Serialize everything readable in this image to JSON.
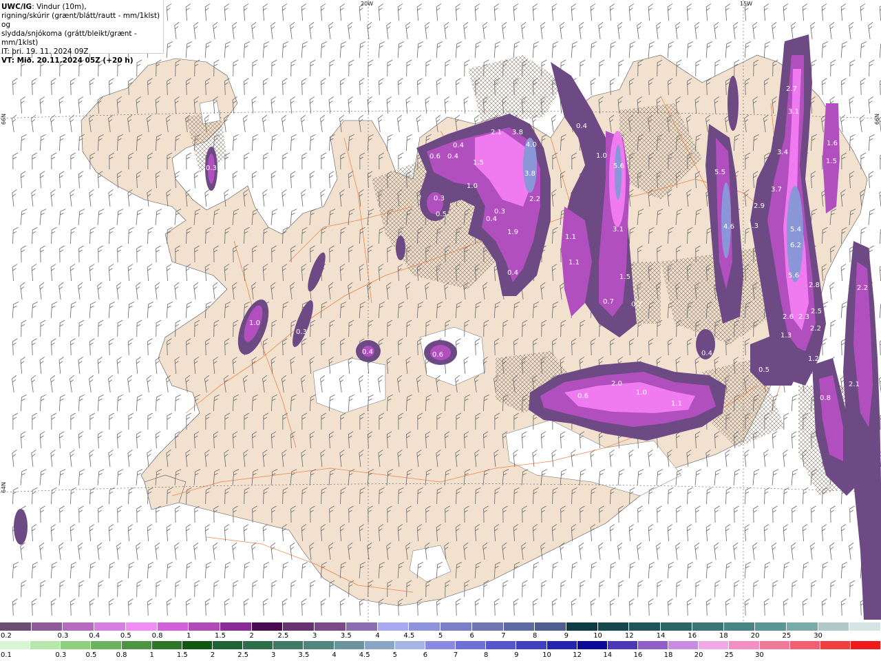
{
  "header": {
    "model": "UWC/IG",
    "line1_rest": ": Vindur (10m),",
    "line2": "rigning/skúrir (grænt/blátt/rautt - mm/1klst) og",
    "line3": "slydda/snjókoma (grátt/bleikt/grænt - mm/1klst)",
    "issue": "IT: þri. 19. 11. 2024 09Z",
    "valid": "VT: Mið. 20.11.2024 05Z (+20 h)"
  },
  "graticule": {
    "lon_top_1": "20W",
    "lon_top_2": "15W",
    "lat_left_1": "66N",
    "lat_left_2": "64N",
    "lat_right_1": "66N"
  },
  "colors": {
    "land": "#f2e1cf",
    "sea": "#ffffff",
    "roads": "#ee7a3a",
    "snow_low": "#6e4a84",
    "snow_mid": "#b24fbf",
    "snow_high": "#f07bf0",
    "snow_core": "#8a96d8"
  },
  "precip_labels": [
    {
      "text": "0.3"
    },
    {
      "text": "1.0"
    },
    {
      "text": "0.3"
    },
    {
      "text": "0.4"
    },
    {
      "text": "0.6"
    },
    {
      "text": "0.6"
    },
    {
      "text": "0.4"
    },
    {
      "text": "1.5"
    },
    {
      "text": "1.0"
    },
    {
      "text": "0.3"
    },
    {
      "text": "0.5"
    },
    {
      "text": "0.4"
    },
    {
      "text": "2.1"
    },
    {
      "text": "3.8"
    },
    {
      "text": "4.0"
    },
    {
      "text": "3.8"
    },
    {
      "text": "2.2"
    },
    {
      "text": "1.9"
    },
    {
      "text": "0.3"
    },
    {
      "text": "0.4"
    },
    {
      "text": "0.4"
    },
    {
      "text": "1.1"
    },
    {
      "text": "1.1"
    },
    {
      "text": "1.0"
    },
    {
      "text": "5.6"
    },
    {
      "text": "3.1"
    },
    {
      "text": "1.5"
    },
    {
      "text": "0.7"
    },
    {
      "text": "0.7"
    },
    {
      "text": "0.4"
    },
    {
      "text": "5.5"
    },
    {
      "text": "4.6"
    },
    {
      "text": "1.3"
    },
    {
      "text": "2.9"
    },
    {
      "text": "3.7"
    },
    {
      "text": "3.4"
    },
    {
      "text": "3.1"
    },
    {
      "text": "2.7"
    },
    {
      "text": "5.4"
    },
    {
      "text": "6.2"
    },
    {
      "text": "5.6"
    },
    {
      "text": "2.8"
    },
    {
      "text": "2.6"
    },
    {
      "text": "2.3"
    },
    {
      "text": "2.5"
    },
    {
      "text": "2.2"
    },
    {
      "text": "1.3"
    },
    {
      "text": "1.2"
    },
    {
      "text": "0.5"
    },
    {
      "text": "2.0"
    },
    {
      "text": "0.6"
    },
    {
      "text": "1.0"
    },
    {
      "text": "1.1"
    },
    {
      "text": "0.4"
    },
    {
      "text": "2.2"
    },
    {
      "text": "2.1"
    },
    {
      "text": "0.8"
    },
    {
      "text": "1.6"
    },
    {
      "text": "1.5"
    }
  ],
  "legend_snow": {
    "colors": [
      "#6a4e74",
      "#8e5c99",
      "#b56cbf",
      "#d77fe0",
      "#ef8ff5",
      "#d062d8",
      "#b14ab9",
      "#8a2c95",
      "#4a0a4e",
      "#68316f",
      "#7a4b86",
      "#8b6fb0",
      "#a9a9f2",
      "#8d94dc",
      "#7a7fc6",
      "#6f76b0",
      "#5b6aa0",
      "#4f5e8e",
      "#0e3a44",
      "#16474f",
      "#1f5458",
      "#2c6565",
      "#3b7575",
      "#4a8585",
      "#5c9595",
      "#7baaaa",
      "#b0c8c8",
      "#d8e4e4"
    ],
    "labels": [
      "0.2",
      "0.3",
      "0.4",
      "0.5",
      "0.8",
      "1",
      "1.5",
      "2",
      "2.5",
      "3",
      "3.5",
      "4",
      "4.5",
      "5",
      "6",
      "7",
      "8",
      "9",
      "10",
      "12",
      "14",
      "16",
      "18",
      "20",
      "25",
      "30"
    ]
  },
  "legend_rain": {
    "colors": [
      "#d8f5d2",
      "#b6e7ab",
      "#8fd07f",
      "#6cb35d",
      "#4c9442",
      "#2d7728",
      "#0f5912",
      "#1e6335",
      "#2f6e4d",
      "#3f7a65",
      "#50867c",
      "#6a95a0",
      "#8aa6c4",
      "#a5b6e6",
      "#8a8ae2",
      "#6f6fd8",
      "#5656cc",
      "#3f3fbf",
      "#2424b0",
      "#0a0a9a",
      "#4b37b8",
      "#8f5ec9",
      "#c88de0",
      "#f0a8e6",
      "#f38fc2",
      "#f07a9a",
      "#f06070",
      "#ee3e3e",
      "#f01a1a"
    ],
    "labels": [
      "0.1",
      "0.3",
      "0.5",
      "0.8",
      "1",
      "1.5",
      "2",
      "2.5",
      "3",
      "3.5",
      "4",
      "4.5",
      "5",
      "6",
      "7",
      "8",
      "9",
      "10",
      "12",
      "14",
      "16",
      "18",
      "20",
      "25",
      "30"
    ]
  }
}
